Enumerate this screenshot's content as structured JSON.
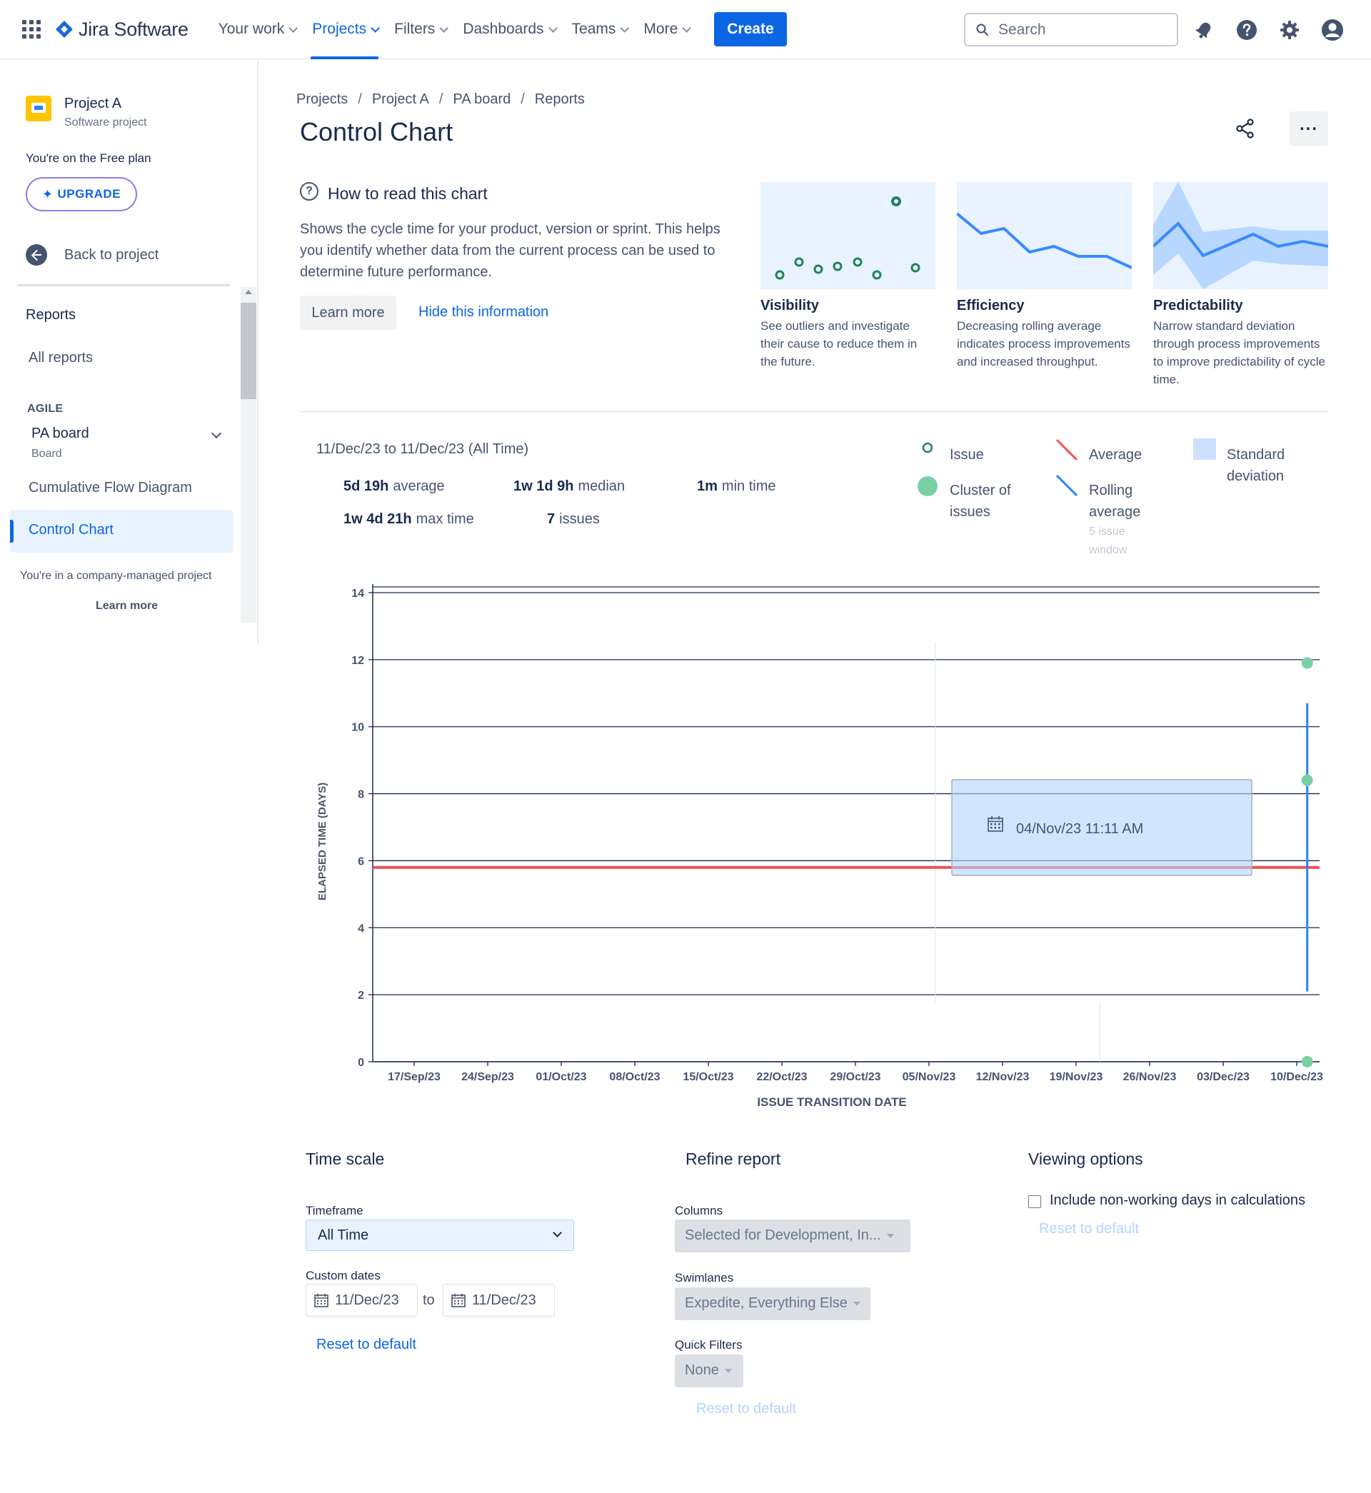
{
  "topnav": {
    "product": "Jira Software",
    "items": [
      {
        "label": "Your work"
      },
      {
        "label": "Projects",
        "active": true
      },
      {
        "label": "Filters"
      },
      {
        "label": "Dashboards"
      },
      {
        "label": "Teams"
      },
      {
        "label": "More"
      }
    ],
    "create_label": "Create",
    "search_placeholder": "Search",
    "icons": [
      "notifications-icon",
      "help-icon",
      "settings-icon",
      "profile-icon"
    ],
    "accent": "#0c66e4"
  },
  "sidebar": {
    "project_name": "Project A",
    "project_type": "Software project",
    "plan_text": "You're on the Free plan",
    "upgrade_label": "UPGRADE",
    "back_label": "Back to project",
    "reports_heading": "Reports",
    "all_reports": "All reports",
    "agile_heading": "AGILE",
    "board_name": "PA board",
    "board_type": "Board",
    "cfd_label": "Cumulative Flow Diagram",
    "control_chart_label": "Control Chart",
    "company_text": "You're in a company-managed project",
    "learn_more": "Learn more"
  },
  "main": {
    "breadcrumb": [
      "Projects",
      "Project A",
      "PA board",
      "Reports"
    ],
    "title": "Control Chart",
    "howto_title": "How to read this chart",
    "howto_desc": "Shows the cycle time for your product, version or sprint. This helps you identify whether data from the current process can be used to determine future performance.",
    "learn_more_btn": "Learn more",
    "hide_info": "Hide this information",
    "cards": [
      {
        "title": "Visibility",
        "desc": "See outliers and investigate their cause to reduce them in the future."
      },
      {
        "title": "Efficiency",
        "desc": "Decreasing rolling average indicates process improvements and increased throughput."
      },
      {
        "title": "Predictability",
        "desc": "Narrow standard deviation through process improvements to improve predictability of cycle time."
      }
    ],
    "range": "11/Dec/23 to 11/Dec/23 (All Time)",
    "stats": {
      "average_val": "5d 19h",
      "average_lbl": "average",
      "median_val": "1w 1d 9h",
      "median_lbl": "median",
      "min_val": "1m",
      "min_lbl": "min time",
      "max_val": "1w 4d 21h",
      "max_lbl": "max time",
      "issues_val": "7",
      "issues_lbl": "issues"
    },
    "legend": {
      "issue": "Issue",
      "cluster_1": "Cluster of",
      "cluster_2": "issues",
      "average": "Average",
      "rolling_1": "Rolling",
      "rolling_2": "average",
      "rolling_sub_1": "5 issue",
      "rolling_sub_2": "window",
      "std_1": "Standard",
      "std_2": "deviation"
    }
  },
  "chart_data": {
    "type": "scatter",
    "xlabel": "ISSUE TRANSITION DATE",
    "ylabel": "ELAPSED TIME (DAYS)",
    "ylim": [
      0,
      14
    ],
    "yticks": [
      0,
      2,
      4,
      6,
      8,
      10,
      12,
      14
    ],
    "x_categories": [
      "17/Sep/23",
      "24/Sep/23",
      "01/Oct/23",
      "08/Oct/23",
      "15/Oct/23",
      "22/Oct/23",
      "29/Oct/23",
      "05/Nov/23",
      "12/Nov/23",
      "19/Nov/23",
      "26/Nov/23",
      "03/Dec/23",
      "10/Dec/23"
    ],
    "average": 5.8,
    "points": [
      {
        "x": "11/Dec/23",
        "y": 11.9
      },
      {
        "x": "11/Dec/23",
        "y": 8.4
      },
      {
        "x": "11/Dec/23",
        "y": 0.0
      }
    ],
    "rolling_average_segment": {
      "x": "11/Dec/23",
      "y_from": 2.1,
      "y_to": 10.7
    },
    "tooltip": "04/Nov/23 11:11 AM",
    "colors": {
      "average": "#ef5350",
      "rolling": "#2684ff",
      "points": "#79d0a5",
      "grid": "#172b4d"
    }
  },
  "controls": {
    "time_scale_h": "Time scale",
    "timeframe_lbl": "Timeframe",
    "timeframe_val": "All Time",
    "custom_dates_lbl": "Custom dates",
    "date_from": "11/Dec/23",
    "to_lbl": "to",
    "date_to": "11/Dec/23",
    "reset_default": "Reset to default",
    "refine_h": "Refine report",
    "columns_lbl": "Columns",
    "columns_val": "Selected for Development, In...",
    "swimlanes_lbl": "Swimlanes",
    "swimlanes_val": "Expedite, Everything Else",
    "quick_filters_lbl": "Quick Filters",
    "quick_filters_val": "None",
    "viewing_h": "Viewing options",
    "nonworking_lbl": "Include non-working days in calculations"
  }
}
